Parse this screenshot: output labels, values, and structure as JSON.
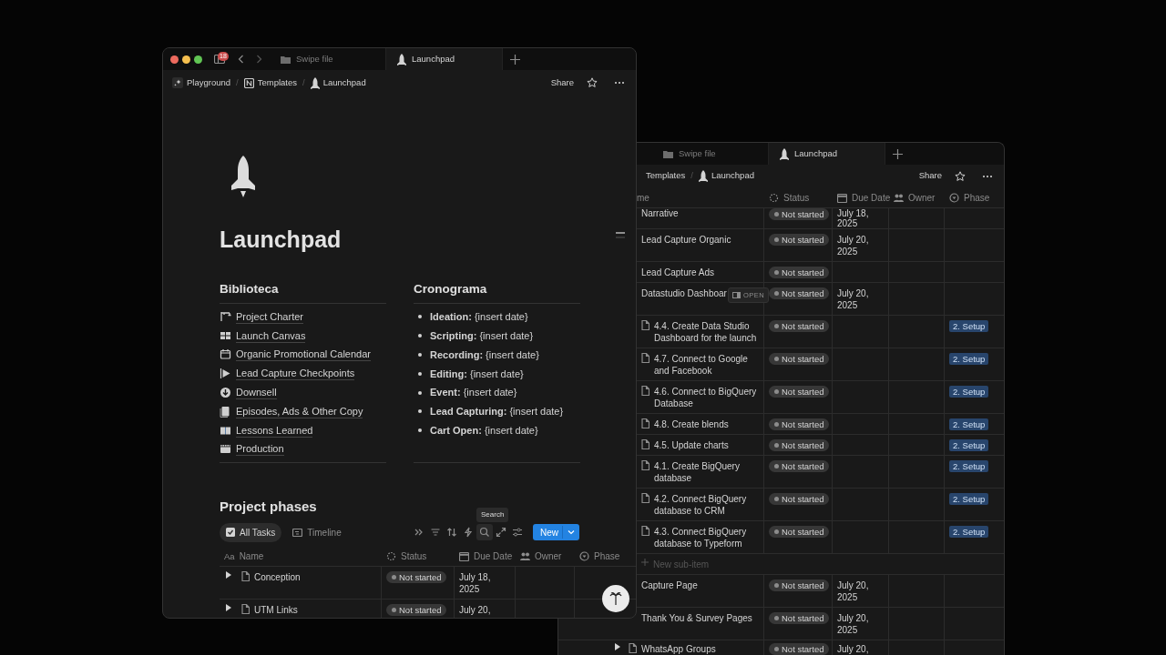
{
  "front_window": {
    "sidebar_badge": "18",
    "tabs": [
      {
        "label": "Swipe file",
        "selected": false
      },
      {
        "label": "Launchpad",
        "selected": true
      }
    ],
    "breadcrumb": [
      {
        "label": "Playground"
      },
      {
        "separator": "/",
        "label": "Templates"
      },
      {
        "separator": "/",
        "label": "Launchpad"
      }
    ],
    "share": "Share",
    "page": {
      "title": "Launchpad",
      "library": {
        "heading": "Biblioteca",
        "items": [
          "Project Charter",
          "Launch Canvas",
          "Organic Promotional Calendar",
          "Lead Capture Checkpoints",
          "Downsell",
          "Episodes, Ads & Other Copy",
          "Lessons Learned",
          "Production"
        ]
      },
      "schedule": {
        "heading": "Cronograma",
        "items": [
          "**Ideation:** {insert date}",
          "**Scripting:** {insert date}",
          "**Recording:** {insert date}",
          "**Editing:** {insert date}",
          "**Event:** {insert date}",
          "**Lead Capturing:** {insert date}",
          "**Cart Open:** {insert date}"
        ]
      },
      "database": {
        "title": "Project phases",
        "tooltip": "Search",
        "new_button": "New",
        "views": [
          {
            "label": "All Tasks",
            "selected": true
          },
          {
            "label": "Timeline",
            "selected": false
          }
        ],
        "columns": [
          {
            "icon_text": "Aa",
            "label": "Name"
          },
          {
            "label": "Status"
          },
          {
            "label": "Due Date"
          },
          {
            "label": "Owner"
          },
          {
            "label": "Phase"
          }
        ],
        "rows": [
          {
            "name": "Conception",
            "status": "Not started",
            "due": "July 18, 2025"
          },
          {
            "name": "UTM Links",
            "status": "Not started",
            "due": "July 20,"
          }
        ]
      }
    }
  },
  "back_window": {
    "tabs": [
      {
        "label": "Swipe file",
        "selected": false
      },
      {
        "label": "Launchpad",
        "selected": true
      }
    ],
    "breadcrumb": [
      {
        "label": "Templates"
      },
      {
        "separator": "/",
        "label": "Launchpad"
      }
    ],
    "share": "Share",
    "columns": [
      "me",
      "Status",
      "Due Date",
      "Owner",
      "Phase"
    ],
    "rows": [
      {
        "kind": "plain",
        "name": "Narrative",
        "status": "Not started",
        "due": "July 18, 2025"
      },
      {
        "kind": "plain",
        "name": "Lead Capture Organic",
        "status": "Not started",
        "due": "July 20, 2025"
      },
      {
        "kind": "plain",
        "name": "Lead Capture Ads",
        "status": "Not started"
      },
      {
        "kind": "plain",
        "name": "Datastudio Dashboar",
        "open_button": "OPEN",
        "status": "Not started",
        "due": "July 20, 2025"
      },
      {
        "kind": "page",
        "name": "4.4. Create Data Studio Dashboard for the launch",
        "status": "Not started",
        "phase": "2. Setup"
      },
      {
        "kind": "page",
        "name": "4.7. Connect to Google and Facebook",
        "status": "Not started",
        "phase": "2. Setup"
      },
      {
        "kind": "page",
        "name": "4.6. Connect to BigQuery Database",
        "status": "Not started",
        "phase": "2. Setup"
      },
      {
        "kind": "page",
        "name": "4.8. Create blends",
        "status": "Not started",
        "phase": "2. Setup"
      },
      {
        "kind": "page",
        "name": "4.5. Update charts",
        "status": "Not started",
        "phase": "2. Setup"
      },
      {
        "kind": "page",
        "name": "4.1. Create BigQuery database",
        "status": "Not started",
        "phase": "2. Setup"
      },
      {
        "kind": "page",
        "name": "4.2. Connect BigQuery database to CRM",
        "status": "Not started",
        "phase": "2. Setup"
      },
      {
        "kind": "page",
        "name": "4.3. Connect BigQuery database to Typeform",
        "status": "Not started",
        "phase": "2. Setup"
      },
      {
        "kind": "new",
        "name": "New sub-item"
      },
      {
        "kind": "plain",
        "name": "Capture Page",
        "status": "Not started",
        "due": "July 20, 2025"
      },
      {
        "kind": "plain",
        "name": "Thank You & Survey Pages",
        "status": "Not started",
        "due": "July 20, 2025"
      },
      {
        "kind": "group",
        "name": "WhatsApp Groups",
        "status": "Not started",
        "due": "July 20,"
      }
    ]
  }
}
